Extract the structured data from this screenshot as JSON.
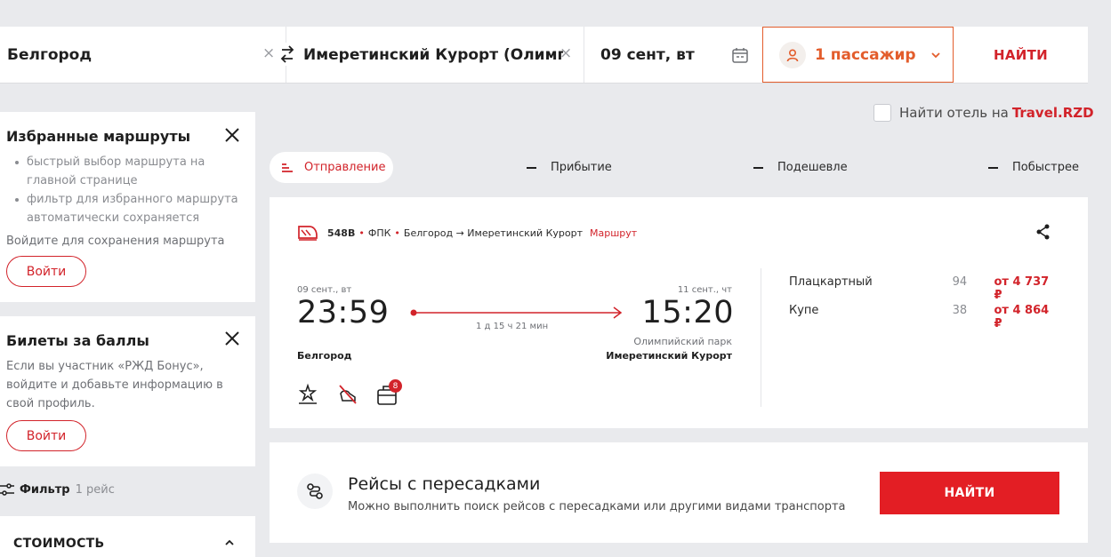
{
  "search": {
    "from": "Белгород",
    "to": "Имеретинский Курорт (Олимпийский парк)",
    "date": "09 сент, вт",
    "passengers": "1 пассажир",
    "find_label": "НАЙТИ"
  },
  "hotel": {
    "label": "Найти отель на ",
    "link": "Travel.RZD"
  },
  "favorites": {
    "title": "Избранные маршруты",
    "bullets": [
      "быстрый выбор маршрута на главной странице",
      "фильтр для избранного маршрута автоматически сохраняется"
    ],
    "note": "Войдите для сохранения маршрута",
    "login_label": "Войти"
  },
  "bonus": {
    "title": "Билеты за баллы",
    "text": "Если вы участник «РЖД Бонус», войдите и добавьте информацию в свой профиль.",
    "login_label": "Войти"
  },
  "filter": {
    "label": "Фильтр",
    "count": "1 рейс"
  },
  "cost": {
    "label": "СТОИМОСТЬ"
  },
  "sort_tabs": [
    "Отправление",
    "Прибытие",
    "Подешевле",
    "Побыстрее"
  ],
  "train": {
    "number": "548В",
    "carrier": "ФПК",
    "route": "Белгород → Имеретинский Курорт",
    "route_link": "Маршрут",
    "dep_date": "09 сент., вт",
    "dep_time": "23:59",
    "arr_date": "11 сент., чт",
    "arr_time": "15:20",
    "duration": "1 д 15 ч 21 мин",
    "arr_station_sub": "Олимпийский парк",
    "dep_city": "Белгород",
    "arr_city": "Имеретинский Курорт",
    "luggage_badge": "8",
    "seats": [
      {
        "class": "Плацкартный",
        "count": "94",
        "price": "от 4 737 ₽"
      },
      {
        "class": "Купе",
        "count": "38",
        "price": "от 4 864 ₽"
      }
    ]
  },
  "transfer": {
    "title": "Рейсы с пересадками",
    "subtitle": "Можно выполнить поиск рейсов с пересадками или другими видами транспорта",
    "button": "НАЙТИ"
  },
  "colors": {
    "accent": "#d2232a",
    "passenger": "#e35d2c"
  }
}
